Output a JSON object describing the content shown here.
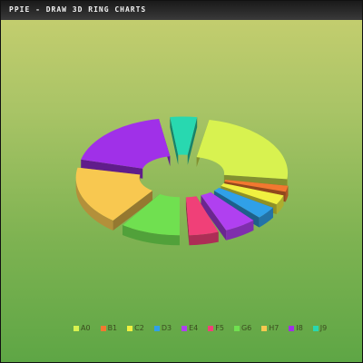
{
  "window_title": "PPIE - DRAW 3D RING CHARTS",
  "chart_data": {
    "type": "pie",
    "variant": "3d-ring",
    "title": "",
    "categories": [
      "A0",
      "B1",
      "C2",
      "D3",
      "E4",
      "F5",
      "G6",
      "H7",
      "I8",
      "J9"
    ],
    "values": [
      21.5,
      2.3,
      3.2,
      3.9,
      5.4,
      5.0,
      9.4,
      16.0,
      16.9,
      4.6
    ],
    "exploded": [
      true,
      true,
      true,
      true,
      true,
      true,
      true,
      true,
      true,
      true
    ],
    "colors": [
      "#d8f250",
      "#f27830",
      "#f0f040",
      "#30a0e8",
      "#b040f0",
      "#f04078",
      "#70e050",
      "#f8c850",
      "#a030e8",
      "#28d8b0"
    ],
    "legend_position": "bottom"
  }
}
